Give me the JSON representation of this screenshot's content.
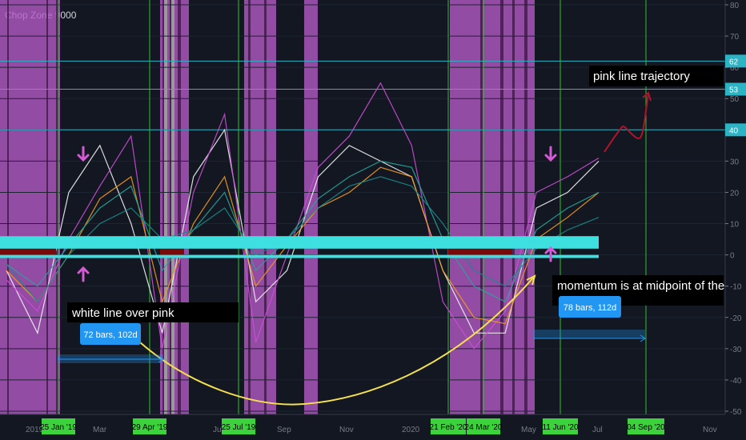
{
  "indicator_title": "Chop Zone 9000",
  "colors": {
    "background": "#131722",
    "grid": "#1e2332",
    "purple_zone": "#b35ac4",
    "green_vline": "#2fc02f",
    "cyan_band": "#3ee0df",
    "dark_red": "#7a0a0a",
    "white_line": "#f2f2f2",
    "pink_line": "#cc4fd6",
    "orange_line": "#f39b1f",
    "teal_line": "#26a69a",
    "dark_teal_line": "#1a8a8a",
    "yellow_arrow": "#f5e050",
    "trajectory": "#b0132a",
    "level_line": "#2cb3c4",
    "label_bg": "#2196f3",
    "date_tag_bg": "#3cd23c"
  },
  "chart_data": {
    "type": "line",
    "title": "Chop Zone 9000",
    "ylim": [
      -50,
      80
    ],
    "y_ticks": [
      "80",
      "70",
      "60",
      "50",
      "40",
      "30",
      "20",
      "10",
      "0",
      "-10",
      "-20",
      "-30",
      "-40",
      "-50"
    ],
    "x_ticks": [
      "2019",
      "Mar",
      "Jul",
      "Sep",
      "Nov",
      "2020",
      "May",
      "Jul",
      "Nov"
    ],
    "level_tags": [
      "62",
      "53",
      "40"
    ],
    "date_tags": [
      "25 Jan '19",
      "29 Apr '19",
      "25 Jul '19",
      "21 Feb '20",
      "24 Mar '20",
      "11 Jun '20",
      "04 Sep '20"
    ],
    "annotations": {
      "white_line_over_pink": "white line over pink",
      "range_1": "72 bars, 102d",
      "momentum": "momentum is at midpoint of the cycle",
      "range_2": "78 bars, 112d",
      "trajectory": "pink line trajectory"
    },
    "series": [
      {
        "values": [
          -5,
          -25,
          20,
          35,
          10,
          -25,
          25,
          40,
          -15,
          -5,
          25,
          35,
          30,
          25,
          -5,
          -25,
          -25,
          15,
          20,
          30
        ]
      },
      {
        "values": [
          -8,
          -18,
          5,
          22,
          38,
          -30,
          20,
          45,
          -28,
          0,
          28,
          38,
          55,
          35,
          -15,
          -30,
          -18,
          20,
          25,
          31
        ]
      },
      {
        "values": [
          -5,
          -15,
          0,
          18,
          25,
          -15,
          10,
          25,
          -10,
          3,
          15,
          20,
          28,
          25,
          -5,
          -20,
          -22,
          5,
          12,
          20
        ]
      },
      {
        "values": [
          -3,
          -10,
          3,
          15,
          22,
          -5,
          8,
          20,
          -5,
          5,
          18,
          25,
          30,
          28,
          5,
          -10,
          -15,
          8,
          15,
          20
        ]
      },
      {
        "values": [
          -3,
          -15,
          0,
          10,
          15,
          5,
          8,
          15,
          0,
          5,
          15,
          22,
          25,
          22,
          10,
          -5,
          -10,
          2,
          8,
          12
        ]
      }
    ]
  }
}
